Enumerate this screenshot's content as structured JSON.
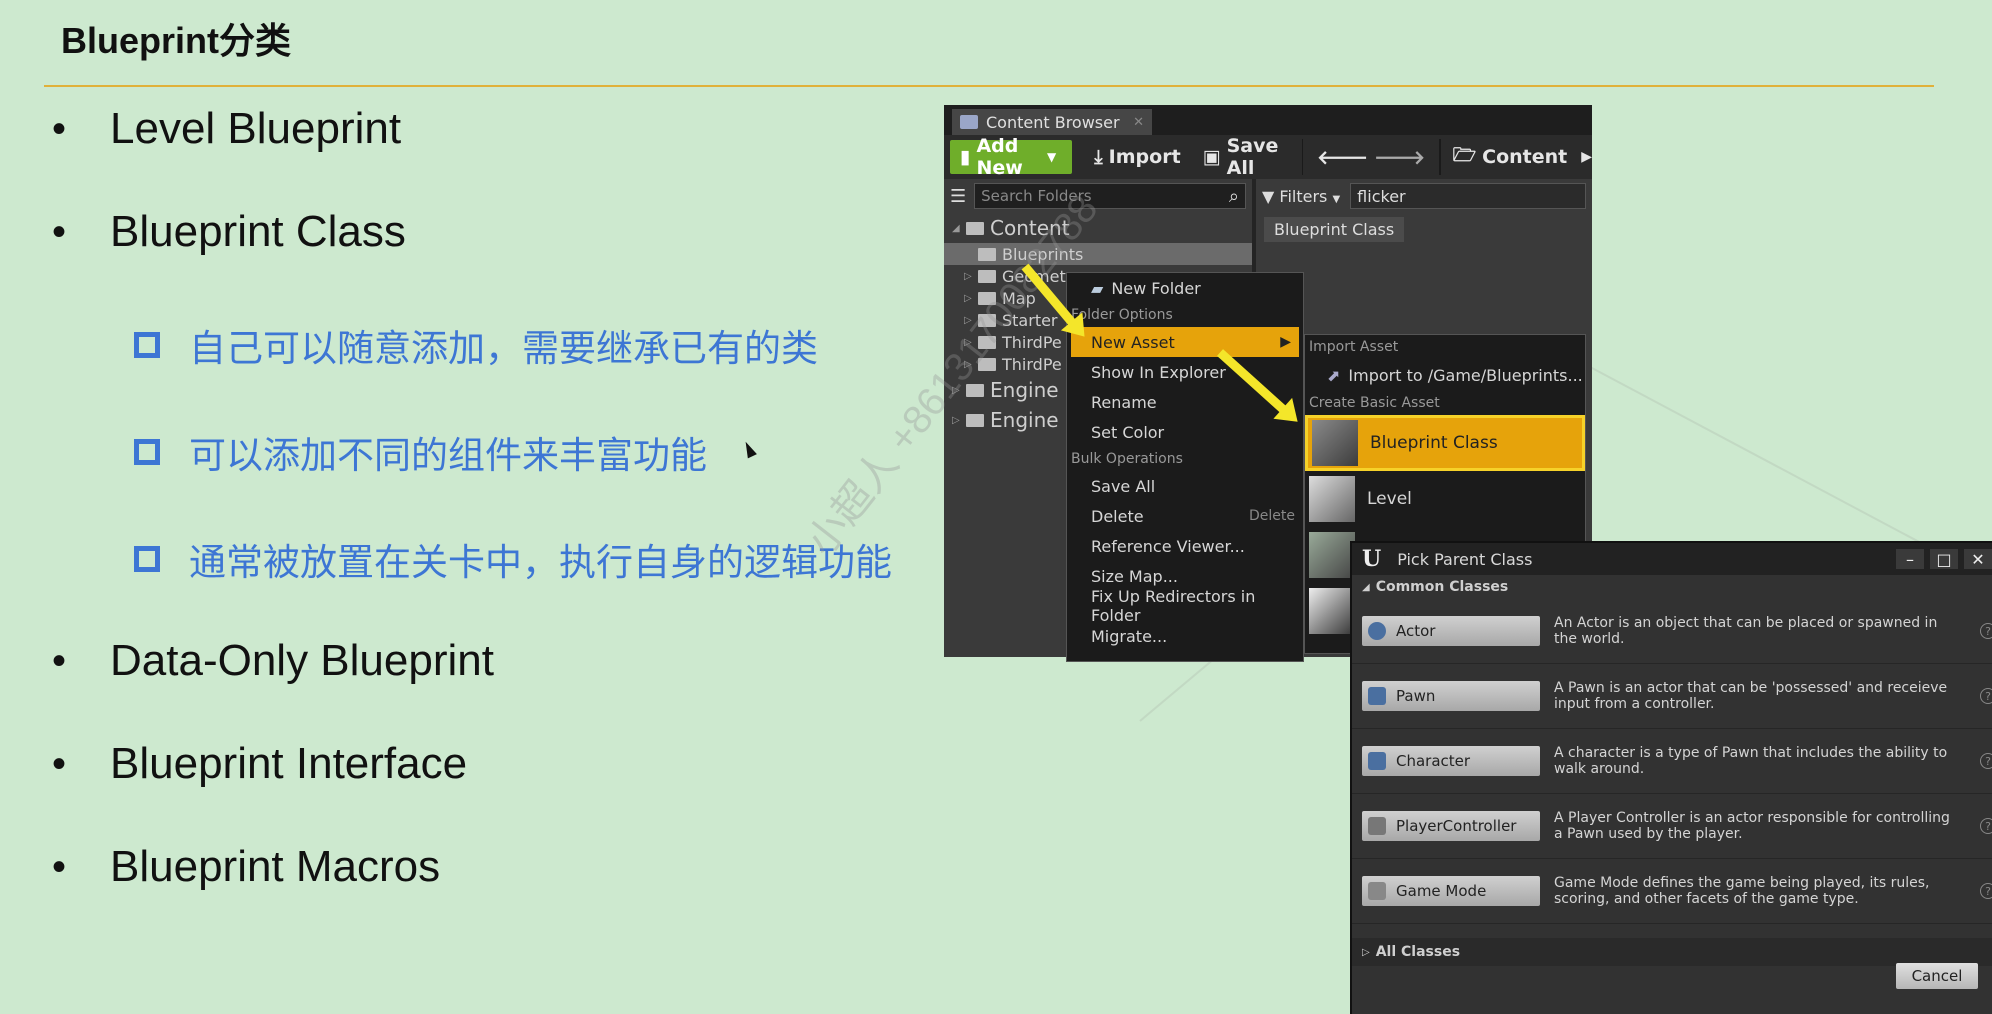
{
  "slide": {
    "title": "Blueprint分类",
    "bullets": [
      "Level Blueprint",
      "Blueprint Class",
      "Data-Only Blueprint",
      "Blueprint Interface",
      "Blueprint Macros"
    ],
    "sub_bullets": [
      "自己可以随意添加，需要继承已有的类",
      "可以添加不同的组件来丰富功能",
      "通常被放置在关卡中，执行自身的逻辑功能"
    ],
    "watermark": "小超人 +8613170082788"
  },
  "content_browser": {
    "tab_label": "Content Browser",
    "toolbar": {
      "add_new": "Add New",
      "import": "Import",
      "save_all": "Save All",
      "path_root": "Content"
    },
    "search_placeholder": "Search Folders",
    "filters_label": "Filters",
    "filter_text": "flicker",
    "result_chip": "Blueprint Class",
    "tree": {
      "content": "Content",
      "blueprints": "Blueprints",
      "children": [
        "Geomet",
        "Map",
        "Starter",
        "ThirdPe",
        "ThirdPe"
      ],
      "engine_1": "Engine C",
      "engine_2": "Engine C"
    }
  },
  "context_menu": {
    "new_folder": "New Folder",
    "folder_options": "Folder Options",
    "new_asset": "New Asset",
    "show_in_explorer": "Show In Explorer",
    "rename": "Rename",
    "set_color": "Set Color",
    "bulk_operations": "Bulk Operations",
    "save_all": "Save All",
    "delete": "Delete",
    "delete_shortcut": "Delete",
    "reference_viewer": "Reference Viewer...",
    "size_map": "Size Map...",
    "fix_up": "Fix Up Redirectors in Folder",
    "migrate": "Migrate..."
  },
  "submenu": {
    "import_asset": "Import Asset",
    "import_to": "Import to /Game/Blueprints...",
    "create_basic_asset": "Create Basic Asset",
    "blueprint_class": "Blueprint Class",
    "level": "Level"
  },
  "pick_parent_class": {
    "title": "Pick Parent Class",
    "common_classes": "Common Classes",
    "classes": [
      {
        "name": "Actor",
        "desc": "An Actor is an object that can be placed or spawned in the world."
      },
      {
        "name": "Pawn",
        "desc": "A Pawn is an actor that can be 'possessed' and receieve input from a controller."
      },
      {
        "name": "Character",
        "desc": "A character is a type of Pawn that includes the ability to walk around."
      },
      {
        "name": "PlayerController",
        "desc": "A Player Controller is an actor responsible for controlling a Pawn used by the player."
      },
      {
        "name": "Game Mode",
        "desc": "Game Mode defines the game being played, its rules, scoring, and other facets of the game type."
      }
    ],
    "all_classes": "All Classes",
    "cancel": "Cancel"
  },
  "colors": {
    "accent_green": "#6fae2a",
    "highlight_orange": "#e6a30b",
    "arrow_yellow": "#f4e62a",
    "sub_bullet_blue": "#3d76d4",
    "title_rule": "#e0b13a"
  }
}
